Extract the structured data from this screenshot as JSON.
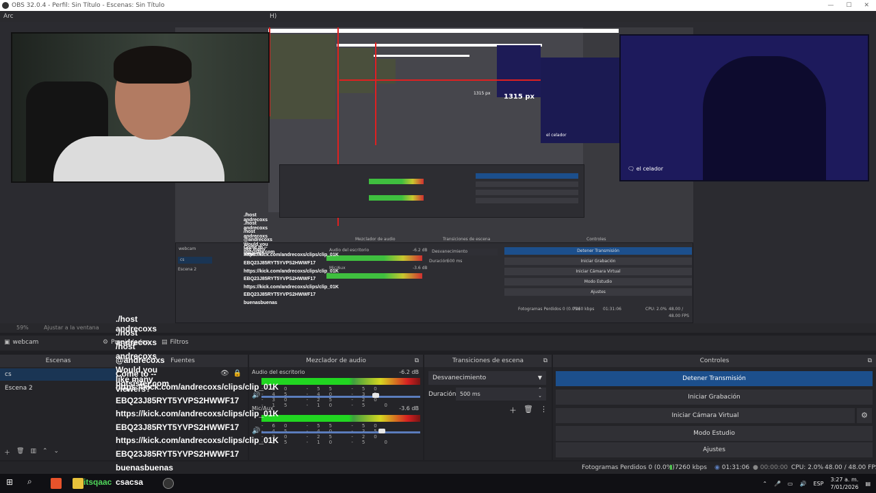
{
  "window": {
    "title": "OBS 32.0.4 - Perfil: Sin Título - Escenas: Sin Título",
    "menu_partial": "Arc",
    "menu_hint": "H)"
  },
  "preview": {
    "px_label": "1315 px",
    "px_label_small": "1315 px",
    "darkcam_label": "el celador",
    "darkcam_small_label": "el celador",
    "zoom": "59%",
    "fit_label": "Ajustar a la ventana"
  },
  "sources_bar": {
    "source_name": "webcam",
    "properties_label": "Propiedades",
    "filters_label": "Filtros"
  },
  "chat": {
    "messages": [
      {
        "user": "ANDRECOXS",
        "color": "#4fd65a",
        "text": "./host andrecoxs"
      },
      {
        "user": "itsqaac",
        "color": "#4fd65a",
        "text": "./host andrecoxs"
      },
      {
        "user": "itsqaac",
        "color": "#4fd65a",
        "text": "/host andrecoxs"
      },
      {
        "user": "clinicelangoraiihbje",
        "color": "#e8d23c",
        "text": "@andrecoxs Would you like many viewers?"
      },
      {
        "user": "",
        "color": "#4fd65a",
        "text": "Come to --botsister.com"
      },
      {
        "user": "ANDRECOXS",
        "color": "#4fd65a",
        "text": "https://kick.com/andrecoxs/clips/clip_01K"
      },
      {
        "user": "",
        "color": "#4fd65a",
        "text": "EBQ23J85RYT5YVPS2HWWF17"
      },
      {
        "user": "ANDRECOXS",
        "color": "#4fd65a",
        "text": "https://kick.com/andrecoxs/clips/clip_01K"
      },
      {
        "user": "",
        "color": "#4fd65a",
        "text": "EBQ23J85RYT5YVPS2HWWF17"
      },
      {
        "user": "ANDRECOXS",
        "color": "#4fd65a",
        "text": "https://kick.com/andrecoxs/clips/clip_01K"
      },
      {
        "user": "",
        "color": "#4fd65a",
        "text": "EBQ23J85RYT5YVPS2HWWF17"
      },
      {
        "user": "itsqaac",
        "color": "#4fd65a",
        "text": "buenasbuenas"
      }
    ]
  },
  "docks": {
    "scenes_header": "Escenas",
    "sources_header": "Fuentes",
    "mixer_header": "Mezclador de audio",
    "transitions_header": "Transiciones de escena",
    "controls_header": "Controles"
  },
  "scenes": [
    {
      "name": "cs",
      "selected": true
    },
    {
      "name": "Escena 2",
      "selected": false
    }
  ],
  "mixer": {
    "tracks": [
      {
        "name": "Audio del escritorio",
        "db": "-6.2 dB",
        "level": 0.72
      },
      {
        "name": "Mic/Aux",
        "db": "-3.6 dB",
        "level": 0.76
      }
    ],
    "ticks": "-60 -55 -50 -45 -40 -35 -30 -25 -20 -15 -10 -5 0"
  },
  "transitions": {
    "selected": "Desvanecimiento",
    "duration_label": "Duración",
    "duration_value": "500 ms"
  },
  "controls": [
    {
      "label": "Detener Transmisión",
      "active": true
    },
    {
      "label": "Iniciar Grabación",
      "active": false
    },
    {
      "label": "Iniciar Cámara Virtual",
      "active": false
    },
    {
      "label": "Modo Estudio",
      "active": false
    },
    {
      "label": "Ajustes",
      "active": false
    }
  ],
  "status": {
    "dropped": "Fotogramas Perdidos 0 (0.0%)",
    "bitrate": "7260 kbps",
    "live_time": "01:31:06",
    "rec_time": "00:00:00",
    "cpu": "CPU: 2.0%",
    "fps": "48.00 / 48.00 FPS"
  },
  "taskbar": {
    "chat_user": "itsqaac",
    "chat_text": "csacsa",
    "lang": "ESP",
    "time": "3:27 a. m.",
    "date": "7/01/2026"
  }
}
